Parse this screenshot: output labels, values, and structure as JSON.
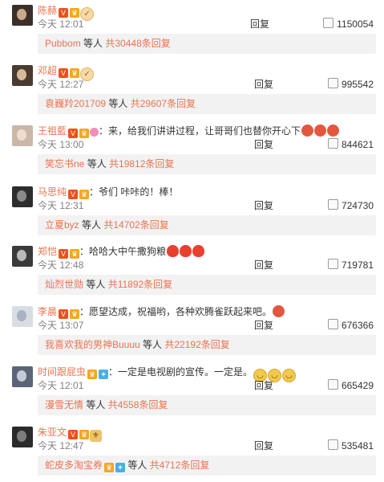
{
  "comments": [
    {
      "name": "陈赫",
      "badges": [
        "v",
        "crown"
      ],
      "emoji_after_name": [
        "thumb"
      ],
      "text": "",
      "time": "今天 12:01",
      "reply_label": "回复",
      "likes": "1150054",
      "sub_user": "Pubbom",
      "sub_mid": " 等人 ",
      "sub_count": "共30448条回复",
      "avatar_colors": [
        "#3b2f2a",
        "#c9a98a"
      ]
    },
    {
      "name": "邓超",
      "badges": [
        "v",
        "crown"
      ],
      "emoji_after_name": [
        "thumb"
      ],
      "text": "",
      "time": "今天 12:27",
      "reply_label": "回复",
      "likes": "995542",
      "sub_user": "袁巍羚201709",
      "sub_mid": " 等人 ",
      "sub_count": "共29607条回复",
      "avatar_colors": [
        "#4a3a30",
        "#d8b89a"
      ]
    },
    {
      "name": "王祖藍",
      "badges": [
        "v",
        "crown"
      ],
      "emoji_after_name": [
        "pink-heart"
      ],
      "text": "：来，给我们讲讲过程，让哥哥们也替你开心下",
      "emoji_after_text": [
        "blush",
        "blush",
        "blush"
      ],
      "time": "今天 13:00",
      "reply_label": "回复",
      "likes": "844621",
      "sub_user": "笑忘书ne",
      "sub_mid": " 等人 ",
      "sub_count": "共19812条回复",
      "avatar_colors": [
        "#c9b7a8",
        "#f1ddd0"
      ]
    },
    {
      "name": "马思纯",
      "badges": [
        "v",
        "crown"
      ],
      "emoji_after_name": [],
      "text": "：爷们 咔咔的！棒！",
      "time": "今天 12:31",
      "reply_label": "回复",
      "likes": "724730",
      "sub_user": "立夏byz",
      "sub_mid": " 等人 ",
      "sub_count": "共14702条回复",
      "avatar_colors": [
        "#2d2d2d",
        "#8a8a8a"
      ]
    },
    {
      "name": "郑恺",
      "badges": [
        "v",
        "crown"
      ],
      "emoji_after_name": [],
      "text": "：哈哈大中午撒狗粮",
      "emoji_after_text": [
        "heart",
        "heart",
        "heart"
      ],
      "time": "今天 12:48",
      "reply_label": "回复",
      "likes": "719781",
      "sub_user": "灿烈世勋",
      "sub_mid": " 等人 ",
      "sub_count": "共11892条回复",
      "avatar_colors": [
        "#3a3a3a",
        "#b9b9b9"
      ]
    },
    {
      "name": "李晨",
      "badges": [
        "v",
        "crown"
      ],
      "emoji_after_name": [],
      "text": "：愿望达成，祝福哟，各种欢腾雀跃起来吧。",
      "emoji_after_text": [
        "blush"
      ],
      "time": "今天 13:07",
      "reply_label": "回复",
      "likes": "676366",
      "sub_user": "我喜欢我的男神Buuuu",
      "sub_mid": " 等人 ",
      "sub_count": "共22192条回复",
      "avatar_colors": [
        "#d8dde4",
        "#a9b3c2"
      ]
    },
    {
      "name": "时间跟屁虫",
      "badges": [
        "crown",
        "lv"
      ],
      "emoji_after_name": [],
      "text": "：一定是电视剧的宣传。一定是。",
      "emoji_after_text": [
        "laugh",
        "laugh",
        "laugh"
      ],
      "time": "今天 12:01",
      "reply_label": "回复",
      "likes": "665429",
      "sub_user": "漫雪无情",
      "sub_mid": " 等人 ",
      "sub_count": "共4558条回复",
      "avatar_colors": [
        "#5a6678",
        "#c6ccd6"
      ]
    },
    {
      "name": "朱亚文",
      "badges": [
        "v",
        "crown"
      ],
      "emoji_after_name": [
        "cheers"
      ],
      "text": "",
      "time": "今天 12:47",
      "reply_label": "回复",
      "likes": "535481",
      "sub_user": "蛇皮多淘宝券",
      "sub_mid": " 等人 ",
      "sub_count": "共4712条回复",
      "avatar_colors": [
        "#2b2b2b",
        "#7d7d7d"
      ]
    }
  ]
}
